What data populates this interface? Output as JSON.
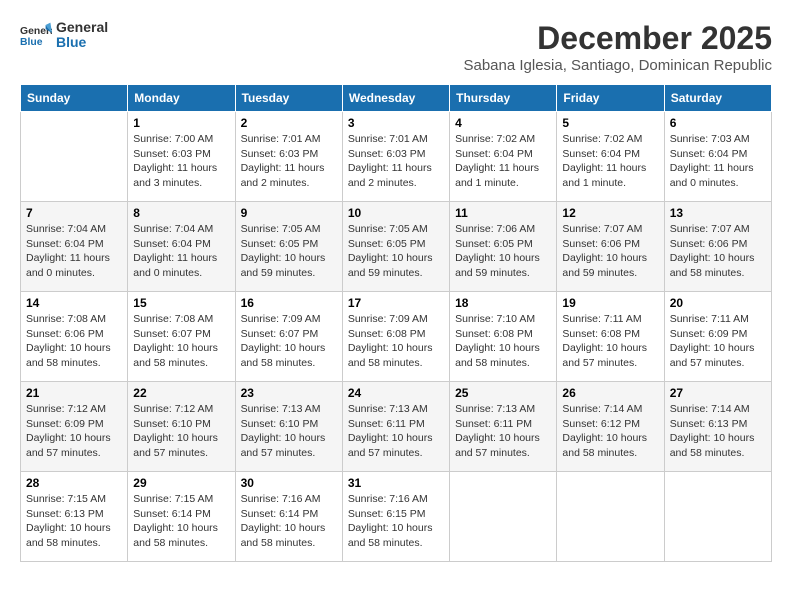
{
  "header": {
    "logo": "GeneralBlue",
    "month": "December 2025",
    "location": "Sabana Iglesia, Santiago, Dominican Republic"
  },
  "weekdays": [
    "Sunday",
    "Monday",
    "Tuesday",
    "Wednesday",
    "Thursday",
    "Friday",
    "Saturday"
  ],
  "weeks": [
    [
      {
        "day": "",
        "sunrise": "",
        "sunset": "",
        "daylight": ""
      },
      {
        "day": "1",
        "sunrise": "Sunrise: 7:00 AM",
        "sunset": "Sunset: 6:03 PM",
        "daylight": "Daylight: 11 hours and 3 minutes."
      },
      {
        "day": "2",
        "sunrise": "Sunrise: 7:01 AM",
        "sunset": "Sunset: 6:03 PM",
        "daylight": "Daylight: 11 hours and 2 minutes."
      },
      {
        "day": "3",
        "sunrise": "Sunrise: 7:01 AM",
        "sunset": "Sunset: 6:03 PM",
        "daylight": "Daylight: 11 hours and 2 minutes."
      },
      {
        "day": "4",
        "sunrise": "Sunrise: 7:02 AM",
        "sunset": "Sunset: 6:04 PM",
        "daylight": "Daylight: 11 hours and 1 minute."
      },
      {
        "day": "5",
        "sunrise": "Sunrise: 7:02 AM",
        "sunset": "Sunset: 6:04 PM",
        "daylight": "Daylight: 11 hours and 1 minute."
      },
      {
        "day": "6",
        "sunrise": "Sunrise: 7:03 AM",
        "sunset": "Sunset: 6:04 PM",
        "daylight": "Daylight: 11 hours and 0 minutes."
      }
    ],
    [
      {
        "day": "7",
        "sunrise": "Sunrise: 7:04 AM",
        "sunset": "Sunset: 6:04 PM",
        "daylight": "Daylight: 11 hours and 0 minutes."
      },
      {
        "day": "8",
        "sunrise": "Sunrise: 7:04 AM",
        "sunset": "Sunset: 6:04 PM",
        "daylight": "Daylight: 11 hours and 0 minutes."
      },
      {
        "day": "9",
        "sunrise": "Sunrise: 7:05 AM",
        "sunset": "Sunset: 6:05 PM",
        "daylight": "Daylight: 10 hours and 59 minutes."
      },
      {
        "day": "10",
        "sunrise": "Sunrise: 7:05 AM",
        "sunset": "Sunset: 6:05 PM",
        "daylight": "Daylight: 10 hours and 59 minutes."
      },
      {
        "day": "11",
        "sunrise": "Sunrise: 7:06 AM",
        "sunset": "Sunset: 6:05 PM",
        "daylight": "Daylight: 10 hours and 59 minutes."
      },
      {
        "day": "12",
        "sunrise": "Sunrise: 7:07 AM",
        "sunset": "Sunset: 6:06 PM",
        "daylight": "Daylight: 10 hours and 59 minutes."
      },
      {
        "day": "13",
        "sunrise": "Sunrise: 7:07 AM",
        "sunset": "Sunset: 6:06 PM",
        "daylight": "Daylight: 10 hours and 58 minutes."
      }
    ],
    [
      {
        "day": "14",
        "sunrise": "Sunrise: 7:08 AM",
        "sunset": "Sunset: 6:06 PM",
        "daylight": "Daylight: 10 hours and 58 minutes."
      },
      {
        "day": "15",
        "sunrise": "Sunrise: 7:08 AM",
        "sunset": "Sunset: 6:07 PM",
        "daylight": "Daylight: 10 hours and 58 minutes."
      },
      {
        "day": "16",
        "sunrise": "Sunrise: 7:09 AM",
        "sunset": "Sunset: 6:07 PM",
        "daylight": "Daylight: 10 hours and 58 minutes."
      },
      {
        "day": "17",
        "sunrise": "Sunrise: 7:09 AM",
        "sunset": "Sunset: 6:08 PM",
        "daylight": "Daylight: 10 hours and 58 minutes."
      },
      {
        "day": "18",
        "sunrise": "Sunrise: 7:10 AM",
        "sunset": "Sunset: 6:08 PM",
        "daylight": "Daylight: 10 hours and 58 minutes."
      },
      {
        "day": "19",
        "sunrise": "Sunrise: 7:11 AM",
        "sunset": "Sunset: 6:08 PM",
        "daylight": "Daylight: 10 hours and 57 minutes."
      },
      {
        "day": "20",
        "sunrise": "Sunrise: 7:11 AM",
        "sunset": "Sunset: 6:09 PM",
        "daylight": "Daylight: 10 hours and 57 minutes."
      }
    ],
    [
      {
        "day": "21",
        "sunrise": "Sunrise: 7:12 AM",
        "sunset": "Sunset: 6:09 PM",
        "daylight": "Daylight: 10 hours and 57 minutes."
      },
      {
        "day": "22",
        "sunrise": "Sunrise: 7:12 AM",
        "sunset": "Sunset: 6:10 PM",
        "daylight": "Daylight: 10 hours and 57 minutes."
      },
      {
        "day": "23",
        "sunrise": "Sunrise: 7:13 AM",
        "sunset": "Sunset: 6:10 PM",
        "daylight": "Daylight: 10 hours and 57 minutes."
      },
      {
        "day": "24",
        "sunrise": "Sunrise: 7:13 AM",
        "sunset": "Sunset: 6:11 PM",
        "daylight": "Daylight: 10 hours and 57 minutes."
      },
      {
        "day": "25",
        "sunrise": "Sunrise: 7:13 AM",
        "sunset": "Sunset: 6:11 PM",
        "daylight": "Daylight: 10 hours and 57 minutes."
      },
      {
        "day": "26",
        "sunrise": "Sunrise: 7:14 AM",
        "sunset": "Sunset: 6:12 PM",
        "daylight": "Daylight: 10 hours and 58 minutes."
      },
      {
        "day": "27",
        "sunrise": "Sunrise: 7:14 AM",
        "sunset": "Sunset: 6:13 PM",
        "daylight": "Daylight: 10 hours and 58 minutes."
      }
    ],
    [
      {
        "day": "28",
        "sunrise": "Sunrise: 7:15 AM",
        "sunset": "Sunset: 6:13 PM",
        "daylight": "Daylight: 10 hours and 58 minutes."
      },
      {
        "day": "29",
        "sunrise": "Sunrise: 7:15 AM",
        "sunset": "Sunset: 6:14 PM",
        "daylight": "Daylight: 10 hours and 58 minutes."
      },
      {
        "day": "30",
        "sunrise": "Sunrise: 7:16 AM",
        "sunset": "Sunset: 6:14 PM",
        "daylight": "Daylight: 10 hours and 58 minutes."
      },
      {
        "day": "31",
        "sunrise": "Sunrise: 7:16 AM",
        "sunset": "Sunset: 6:15 PM",
        "daylight": "Daylight: 10 hours and 58 minutes."
      },
      {
        "day": "",
        "sunrise": "",
        "sunset": "",
        "daylight": ""
      },
      {
        "day": "",
        "sunrise": "",
        "sunset": "",
        "daylight": ""
      },
      {
        "day": "",
        "sunrise": "",
        "sunset": "",
        "daylight": ""
      }
    ]
  ]
}
